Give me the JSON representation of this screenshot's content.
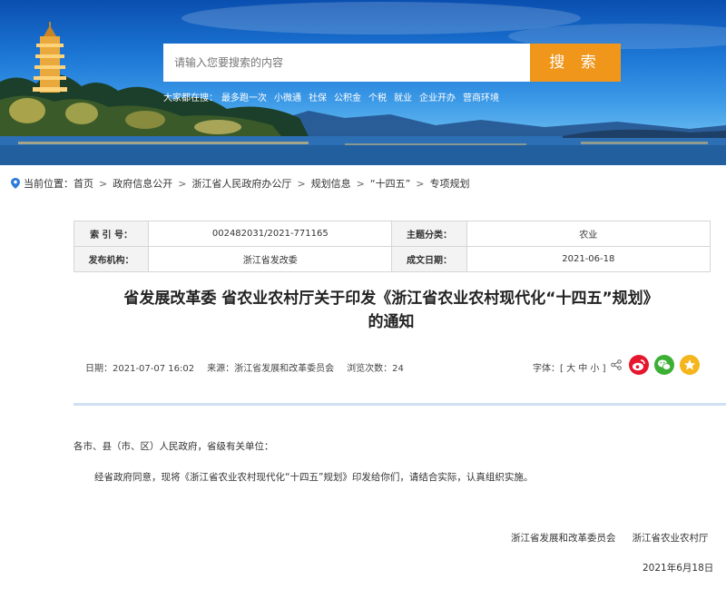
{
  "header": {
    "search_placeholder": "请输入您要搜索的内容",
    "search_button": "搜 索",
    "hot_label": "大家都在搜：",
    "hot_items": [
      "最多跑一次",
      "小微通",
      "社保",
      "公积金",
      "个税",
      "就业",
      "企业开办",
      "营商环境"
    ]
  },
  "breadcrumb": {
    "label": "当前位置：",
    "items": [
      "首页",
      "政府信息公开",
      "浙江省人民政府办公厅",
      "规划信息",
      "“十四五”",
      "专项规划"
    ]
  },
  "info": {
    "index_key": "索 引 号：",
    "index_value": "002482031/2021-771165",
    "topic_key": "主题分类：",
    "topic_value": "农业",
    "issuer_key": "发布机构：",
    "issuer_value": "浙江省发改委",
    "date_key": "成文日期：",
    "date_value": "2021-06-18"
  },
  "article": {
    "title_line1": "省发展改革委 省农业农村厅关于印发《浙江省农业农村现代化“十四五”规划》",
    "title_line2": "的通知",
    "date": "日期：2021-07-07 16:02",
    "source": "来源：浙江省发展和改革委员会",
    "views": "浏览次数：24",
    "font_label": "字体：[ 大 中 小 ]",
    "greeting": "各市、县（市、区）人民政府，省级有关单位：",
    "paragraph": "经省政府同意，现将《浙江省农业农村现代化“十四五”规划》印发给你们，请结合实际，认真组织实施。",
    "signer1": "浙江省发展和改革委员会",
    "signer2": "浙江省农业农村厅",
    "sign_date": "2021年6月18日"
  },
  "colors": {
    "search_button": "#f0961b",
    "weibo": "#e6162d",
    "wechat": "#3cb034",
    "favorite": "#f5b51c"
  },
  "icons": [
    "location-pin-icon",
    "share-icon",
    "weibo-icon",
    "wechat-icon",
    "star-icon"
  ]
}
